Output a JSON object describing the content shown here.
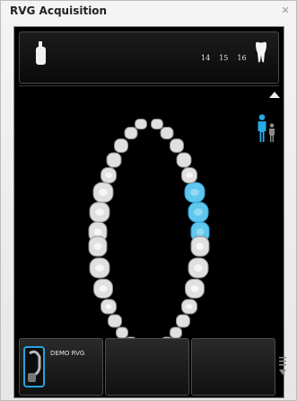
{
  "window": {
    "title": "RVG Acquisition",
    "close_glyph": "✕"
  },
  "header": {
    "sensor_icon": "sensor-icon",
    "tooth_icon": "molar-tooth-icon",
    "tooth_numbers": [
      "14",
      "15",
      "16"
    ],
    "scroll_up_icon": "up-arrow-icon"
  },
  "patient_view_icon": "person-icon",
  "dental_arch": {
    "selected_teeth": [
      "14",
      "15",
      "16"
    ],
    "selected_color": "#5fc7ec",
    "unselected_color": "#e0e0e0"
  },
  "sensor_slots": [
    {
      "label": "DEMO RVG",
      "icon": "rvg-sensor-icon",
      "active": true
    },
    {
      "label": "",
      "active": false
    },
    {
      "label": "",
      "active": false
    }
  ],
  "colors": {
    "accent": "#24a3e0",
    "panel_bg": "#000000"
  }
}
